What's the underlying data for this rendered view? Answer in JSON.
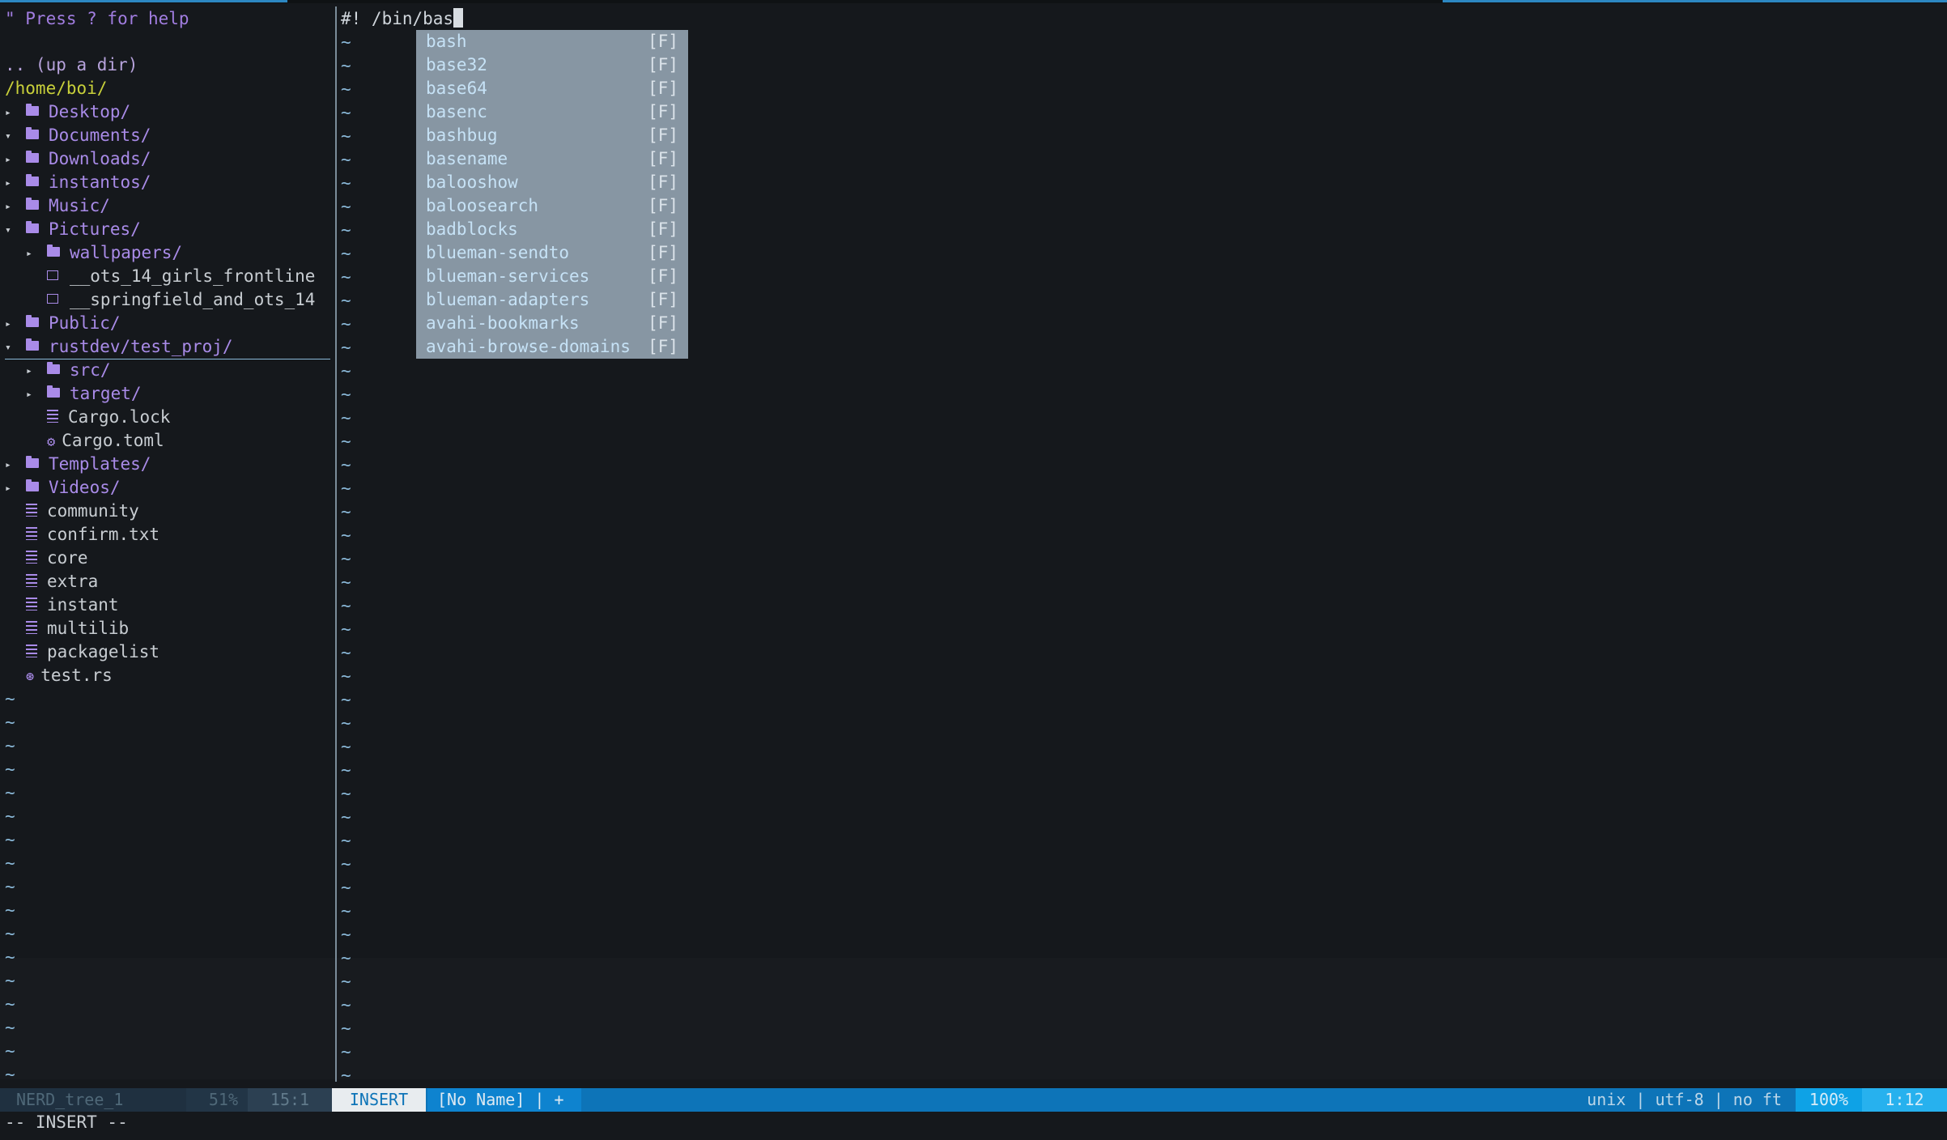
{
  "tree": {
    "help": "\" Press ? for help",
    "updir": ".. (up a dir)",
    "root": "/home/boi/",
    "entries": [
      {
        "label": "Desktop/",
        "kind": "dir",
        "arrow": "▸"
      },
      {
        "label": "Documents/",
        "kind": "dir",
        "arrow": "▾"
      },
      {
        "label": "Downloads/",
        "kind": "dir",
        "arrow": "▸"
      },
      {
        "label": "instantos/",
        "kind": "dir",
        "arrow": "▸"
      },
      {
        "label": "Music/",
        "kind": "dir",
        "arrow": "▸"
      },
      {
        "label": "Pictures/",
        "kind": "dir",
        "arrow": "▾"
      },
      {
        "label": "wallpapers/",
        "kind": "dir",
        "arrow": "▸"
      },
      {
        "label": "__ots_14_girls_frontline",
        "kind": "image",
        "arrow": ""
      },
      {
        "label": "__springfield_and_ots_14",
        "kind": "image",
        "arrow": ""
      },
      {
        "label": "Public/",
        "kind": "dir",
        "arrow": "▸"
      },
      {
        "label": "rustdev/test_proj/",
        "kind": "dir",
        "arrow": "▾"
      },
      {
        "label": "src/",
        "kind": "dir",
        "arrow": "▸"
      },
      {
        "label": "target/",
        "kind": "dir",
        "arrow": "▸"
      },
      {
        "label": "Cargo.lock",
        "kind": "file",
        "arrow": ""
      },
      {
        "label": "Cargo.toml",
        "kind": "config",
        "arrow": ""
      },
      {
        "label": "Templates/",
        "kind": "dir",
        "arrow": "▸"
      },
      {
        "label": "Videos/",
        "kind": "dir",
        "arrow": "▸"
      },
      {
        "label": "community",
        "kind": "file",
        "arrow": ""
      },
      {
        "label": "confirm.txt",
        "kind": "file",
        "arrow": ""
      },
      {
        "label": "core",
        "kind": "file",
        "arrow": ""
      },
      {
        "label": "extra",
        "kind": "file",
        "arrow": ""
      },
      {
        "label": "instant",
        "kind": "file",
        "arrow": ""
      },
      {
        "label": "multilib",
        "kind": "file",
        "arrow": ""
      },
      {
        "label": "packagelist",
        "kind": "file",
        "arrow": ""
      },
      {
        "label": "test.rs",
        "kind": "rust",
        "arrow": ""
      }
    ],
    "tilde": "~"
  },
  "editor": {
    "line1": "#! /bin/bas",
    "tilde": "~"
  },
  "completion": {
    "items": [
      {
        "word": "bash",
        "kind": "[F]"
      },
      {
        "word": "base32",
        "kind": "[F]"
      },
      {
        "word": "base64",
        "kind": "[F]"
      },
      {
        "word": "basenc",
        "kind": "[F]"
      },
      {
        "word": "bashbug",
        "kind": "[F]"
      },
      {
        "word": "basename",
        "kind": "[F]"
      },
      {
        "word": "balooshow",
        "kind": "[F]"
      },
      {
        "word": "baloosearch",
        "kind": "[F]"
      },
      {
        "word": "badblocks",
        "kind": "[F]"
      },
      {
        "word": "blueman-sendto",
        "kind": "[F]"
      },
      {
        "word": "blueman-services",
        "kind": "[F]"
      },
      {
        "word": "blueman-adapters",
        "kind": "[F]"
      },
      {
        "word": "avahi-bookmarks",
        "kind": "[F]"
      },
      {
        "word": "avahi-browse-domains",
        "kind": "[F]"
      }
    ]
  },
  "statusbar": {
    "tree_name": "NERD_tree_1",
    "tree_percent": "51%",
    "tree_position": "15:1",
    "mode": "INSERT",
    "buffer": "[No Name] | +",
    "info": "unix | utf-8 | no ft",
    "zoom": "100%",
    "line_col": "1:12"
  },
  "cmdline": "-- INSERT --",
  "colors": {
    "background": "#15181c",
    "accent": "#0d74b8",
    "directory": "#a98be8",
    "root_path": "#c8d03a",
    "popup": "#8796a3"
  }
}
